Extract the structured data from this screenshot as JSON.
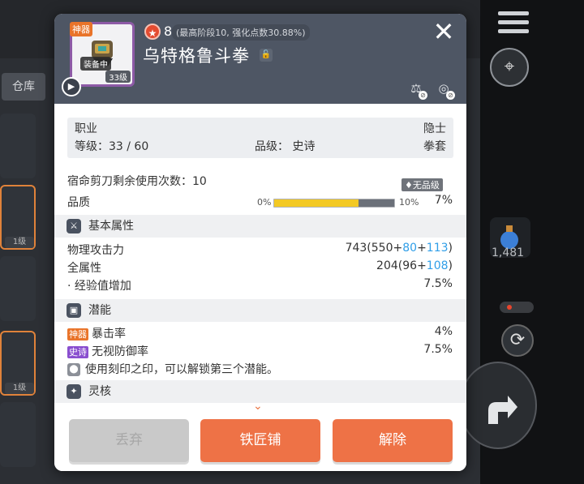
{
  "background": {
    "tabs": [
      "仓库"
    ],
    "slot_badges": [
      "1级",
      "1级"
    ],
    "potion_count": "1,481"
  },
  "header": {
    "item_tag": "神器",
    "equipped_label": "装备中",
    "item_level": "33级",
    "star_count": "8",
    "star_note": "(最高阶段10, 强化点数30.88%)",
    "item_name": "乌特格鲁斗拳"
  },
  "info": {
    "job_label": "职业",
    "job_value": "隐士",
    "level_label": "等级：33 / 60",
    "grade_label": "品级： 史诗",
    "type_value": "拳套"
  },
  "fate": {
    "scissors_label": "宿命剪刀剩余使用次数：10",
    "no_grade_tag": "无品级",
    "quality_label": "品质",
    "quality_min": "0%",
    "quality_max": "10%",
    "quality_value": "7%",
    "quality_fill_fraction": 0.7
  },
  "basic": {
    "title": "基本属性",
    "stats": [
      {
        "name": "物理攻击力",
        "total": "743",
        "base": "550",
        "bonus1": "80",
        "bonus2": "113"
      },
      {
        "name": "全属性",
        "total": "204",
        "base": "96",
        "bonus1": "108"
      }
    ],
    "exp_label": "· 经验值增加",
    "exp_value": "7.5%"
  },
  "potential": {
    "title": "潜能",
    "lines": [
      {
        "tag": "神器",
        "name": "暴击率",
        "value": "4%"
      },
      {
        "tag": "史诗",
        "name": "无视防御率",
        "value": "7.5%"
      }
    ],
    "hint": "使用刻印之印，可以解锁第三个潜能。"
  },
  "core": {
    "title": "灵核"
  },
  "buttons": {
    "discard": "丢弃",
    "smith": "铁匠铺",
    "release": "解除"
  },
  "colors": {
    "accent": "#ee7246",
    "header_bg": "#4e5664",
    "bonus_blue": "#2f9ee8",
    "quality_bar": "#f3c924"
  }
}
